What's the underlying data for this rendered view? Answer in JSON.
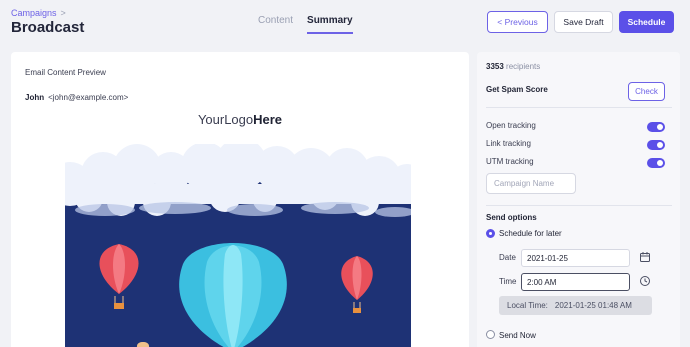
{
  "header": {
    "breadcrumb": "Campaigns",
    "breadcrumb_sep": ">",
    "title": "Broadcast",
    "tabs": [
      {
        "label": "Content",
        "active": false
      },
      {
        "label": "Summary",
        "active": true
      }
    ],
    "buttons": {
      "previous": "< Previous",
      "save_draft": "Save Draft",
      "schedule": "Schedule"
    }
  },
  "preview": {
    "heading": "Email Content Preview",
    "to_name": "John",
    "to_email": "<john@example.com>",
    "logo_regular": "YourLogo",
    "logo_bold": "Here"
  },
  "summary": {
    "recipient_count": "3353",
    "recipient_label": "recipients",
    "spam_score_label": "Get Spam Score",
    "check_label": "Check",
    "tracking": [
      {
        "label": "Open tracking",
        "enabled": true
      },
      {
        "label": "Link tracking",
        "enabled": true
      },
      {
        "label": "UTM tracking",
        "enabled": true
      }
    ],
    "campaign_name_placeholder": "Campaign Name",
    "send_options_label": "Send options",
    "schedule_later_label": "Schedule for later",
    "date_label": "Date",
    "date_value": "2021-01-25",
    "time_label": "Time",
    "time_value": "2:00 AM",
    "local_time_label": "Local Time:",
    "local_time_value": "2021-01-25 01:48 AM",
    "send_now_label": "Send Now"
  },
  "colors": {
    "accent": "#5b50e8",
    "sky": "#1e3275",
    "balloon_red": "#e8505b",
    "balloon_blue": "#5fd4ec"
  },
  "icons": [
    "calendar-icon",
    "clock-icon"
  ]
}
